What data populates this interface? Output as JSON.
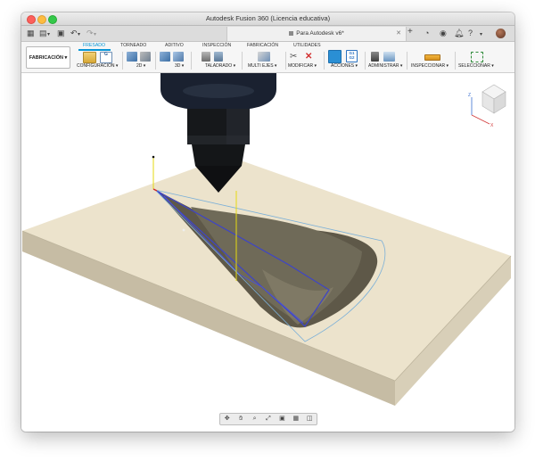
{
  "window": {
    "title": "Autodesk Fusion 360 (Licencia educativa)"
  },
  "document_tab": {
    "label": "Para Autodesk v6*"
  },
  "workspace": {
    "label": "FABRICACIÓN ▾"
  },
  "ribbon_tabs": [
    {
      "label": "FRESADO",
      "active": true
    },
    {
      "label": "TORNEADO",
      "active": false
    },
    {
      "label": "ADITIVO",
      "active": false
    },
    {
      "label": "INSPECCIÓN",
      "active": false
    },
    {
      "label": "FABRICACIÓN",
      "active": false
    },
    {
      "label": "UTILIDADES",
      "active": false
    }
  ],
  "ribbon_groups": [
    {
      "label": "CONFIGURACIÓN ▾"
    },
    {
      "label": "2D ▾"
    },
    {
      "label": "3D ▾"
    },
    {
      "label": "TALADRADO ▾"
    },
    {
      "label": "MULTI EJES ▾"
    },
    {
      "label": "MODIFICAR ▾"
    },
    {
      "label": "ACCIONES ▾"
    },
    {
      "label": "ADMINISTRAR ▾"
    },
    {
      "label": "INSPECCIONAR ▾"
    },
    {
      "label": "SELECCIONAR ▾"
    }
  ],
  "nc_code": {
    "line1": "G1",
    "line2": "G2"
  },
  "setup_code": "G",
  "viewcube": {
    "axis_z": "Z",
    "axis_x": "X",
    "axis_y": "Y"
  },
  "colors": {
    "accent": "#0696d7",
    "stock": "#ece3cc",
    "stock_side_front": "#c9bfa7",
    "stock_side_right": "#d9d0b8",
    "pocket": "#5c5747",
    "toolpath": "#3d44c8",
    "spindle": "#15181d"
  },
  "navigation_bar": [
    {
      "icon": "orbit-icon"
    },
    {
      "icon": "pan-icon"
    },
    {
      "icon": "zoom-icon"
    },
    {
      "icon": "fit-icon"
    },
    {
      "icon": "display-settings-icon"
    },
    {
      "icon": "grid-icon"
    },
    {
      "icon": "viewports-icon"
    }
  ]
}
